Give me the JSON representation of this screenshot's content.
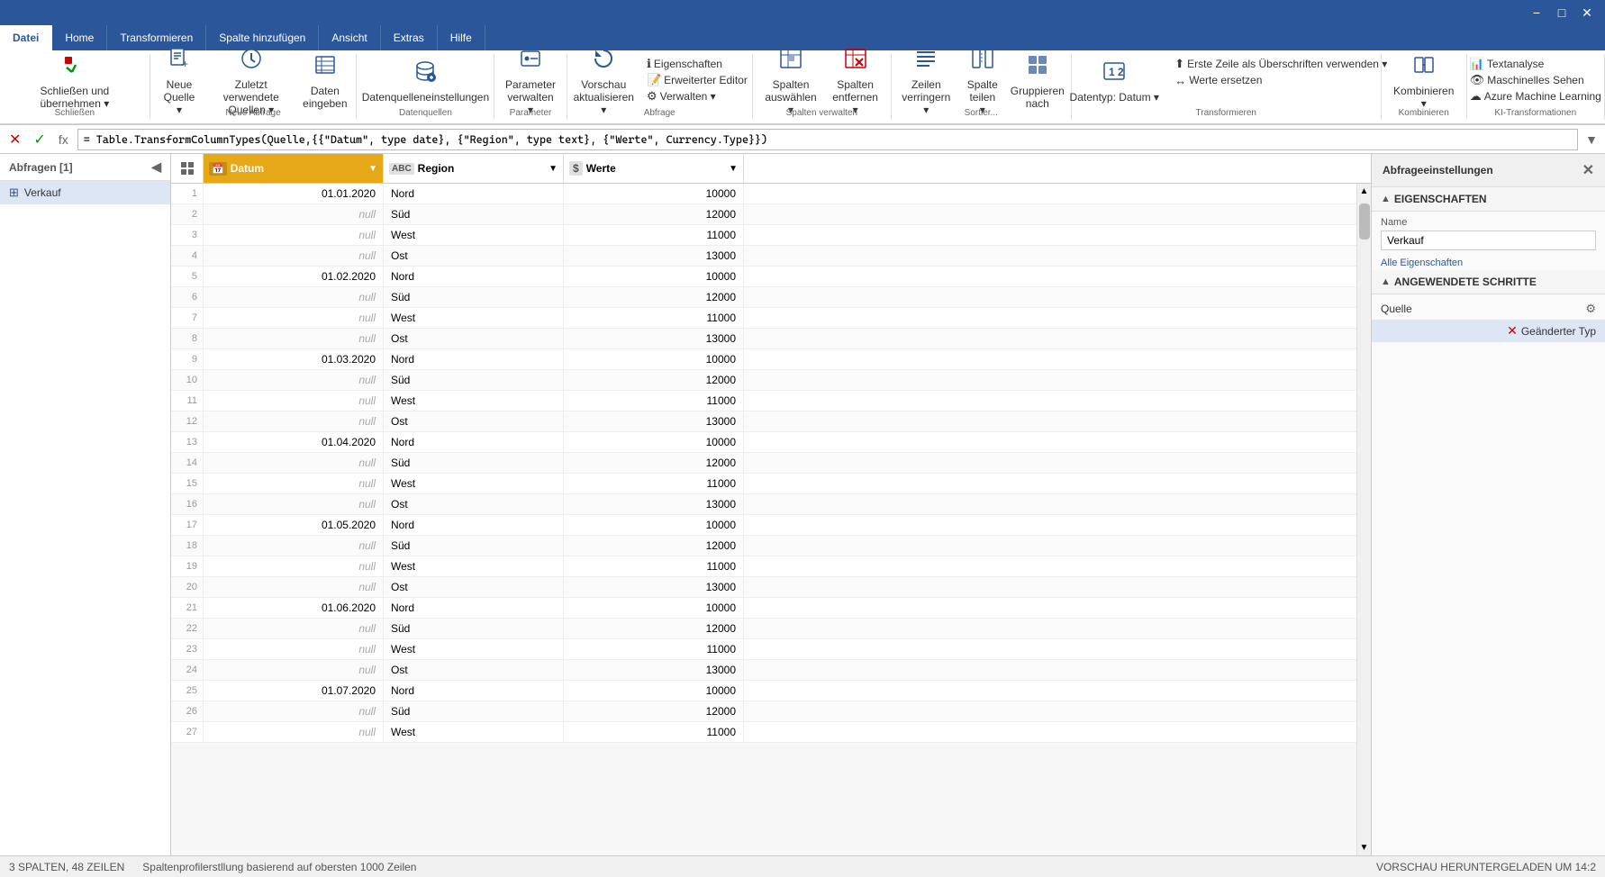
{
  "titlebar": {
    "minimize": "−",
    "maximize": "□",
    "close": "✕"
  },
  "ribbon": {
    "tabs": [
      {
        "id": "datei",
        "label": "Datei",
        "active": true
      },
      {
        "id": "home",
        "label": "Home",
        "active": false
      },
      {
        "id": "transformieren",
        "label": "Transformieren",
        "active": false
      },
      {
        "id": "spalte_hinzufuegen",
        "label": "Spalte hinzufügen",
        "active": false
      },
      {
        "id": "ansicht",
        "label": "Ansicht",
        "active": false
      },
      {
        "id": "extras",
        "label": "Extras",
        "active": false
      },
      {
        "id": "hilfe",
        "label": "Hilfe",
        "active": false
      }
    ],
    "groups": {
      "schliessen": {
        "label": "Schließen",
        "buttons": [
          {
            "id": "schliessen_uebernehmen",
            "icon": "✓",
            "label": "Schließen und\nübernehmen ▾"
          }
        ]
      },
      "neue_abfrage": {
        "label": "Neue Abfrage",
        "buttons": [
          {
            "id": "neue_quelle",
            "icon": "📄",
            "label": "Neue\nQuelle ▾"
          },
          {
            "id": "zuletzt",
            "icon": "🕐",
            "label": "Zuletzt verwendete\nQuellen ▾"
          },
          {
            "id": "daten_eingeben",
            "icon": "📋",
            "label": "Daten\neingeben"
          }
        ]
      },
      "datenquellen": {
        "label": "Datenquellen",
        "buttons": [
          {
            "id": "datenquelleneinstellungen",
            "icon": "🔌",
            "label": "Datenquelleneinstellungen"
          }
        ]
      },
      "parameter": {
        "label": "Parameter",
        "buttons": [
          {
            "id": "parameter_verwalten",
            "icon": "⚙",
            "label": "Parameter\nverwalten ▾"
          }
        ]
      },
      "abfrage": {
        "label": "Abfrage",
        "buttons": [
          {
            "id": "vorschau_aktualisieren",
            "icon": "🔄",
            "label": "Vorschau\naktualisieren ▾"
          },
          {
            "id": "eigenschaften",
            "icon": "ℹ",
            "label": "Eigenschaften"
          },
          {
            "id": "erweiterter_editor",
            "icon": "📝",
            "label": "Erweiterter Editor"
          },
          {
            "id": "verwalten",
            "icon": "⚙",
            "label": "Verwalten ▾"
          }
        ]
      },
      "spalten_verwalten": {
        "label": "Spalten verwalten",
        "buttons": [
          {
            "id": "spalten_auswaehlen",
            "icon": "▦",
            "label": "Spalten\nauswählen ▾"
          },
          {
            "id": "spalten_entfernen",
            "icon": "✂",
            "label": "Spalten\nentfernen ▾"
          }
        ]
      },
      "sortier": {
        "label": "Sortier...",
        "buttons": [
          {
            "id": "zeilen_verringern",
            "icon": "≡",
            "label": "Zeilen\nverringern ▾"
          },
          {
            "id": "spalte_teilen",
            "icon": "⧺",
            "label": "Spalte\nteilen ▾"
          },
          {
            "id": "gruppieren_nach",
            "icon": "⊞",
            "label": "Gruppieren\nnach"
          }
        ]
      },
      "transformieren": {
        "label": "Transformieren",
        "buttons": [
          {
            "id": "datentyp",
            "icon": "🔢",
            "label": "Datentyp: Datum ▾"
          },
          {
            "id": "erste_zeile",
            "icon": "⬆",
            "label": "Erste Zeile als Überschriften verwenden ▾"
          },
          {
            "id": "werte_ersetzen",
            "icon": "↔",
            "label": "Werte ersetzen"
          }
        ]
      },
      "kombinieren": {
        "label": "Kombinieren",
        "buttons": [
          {
            "id": "kombinieren_btn",
            "icon": "⊕",
            "label": "Kombinieren ▾"
          }
        ]
      },
      "ki_transformationen": {
        "label": "KI-Transformationen",
        "buttons": [
          {
            "id": "textanalyse",
            "icon": "📊",
            "label": "Textanalyse"
          },
          {
            "id": "maschinelles_sehen",
            "icon": "👁",
            "label": "Maschinelles Sehen"
          },
          {
            "id": "azure_ml",
            "icon": "☁",
            "label": "Azure Machine Learning"
          }
        ]
      }
    }
  },
  "formula_bar": {
    "cancel": "✕",
    "confirm": "✓",
    "fx": "fx",
    "formula": "= Table.TransformColumnTypes(Quelle,{{\"Datum\", type date}, {\"Region\", type text}, {\"Werte\", Currency.Type}})"
  },
  "queries_panel": {
    "header": "Abfragen [1]",
    "items": [
      {
        "id": "verkauf",
        "label": "Verkauf",
        "active": true
      }
    ]
  },
  "grid": {
    "columns": [
      {
        "id": "datum",
        "label": "Datum",
        "type_icon": "📅",
        "type_text": "Dat",
        "active": true
      },
      {
        "id": "region",
        "label": "Region",
        "type_icon": "ABC",
        "type_text": "ABC",
        "active": false
      },
      {
        "id": "werte",
        "label": "Werte",
        "type_icon": "$",
        "type_text": "$",
        "active": false
      }
    ],
    "rows": [
      {
        "num": 1,
        "datum": "01.01.2020",
        "region": "Nord",
        "werte": "10000"
      },
      {
        "num": 2,
        "datum": "null",
        "region": "Süd",
        "werte": "12000"
      },
      {
        "num": 3,
        "datum": "null",
        "region": "West",
        "werte": "11000"
      },
      {
        "num": 4,
        "datum": "null",
        "region": "Ost",
        "werte": "13000"
      },
      {
        "num": 5,
        "datum": "01.02.2020",
        "region": "Nord",
        "werte": "10000"
      },
      {
        "num": 6,
        "datum": "null",
        "region": "Süd",
        "werte": "12000"
      },
      {
        "num": 7,
        "datum": "null",
        "region": "West",
        "werte": "11000"
      },
      {
        "num": 8,
        "datum": "null",
        "region": "Ost",
        "werte": "13000"
      },
      {
        "num": 9,
        "datum": "01.03.2020",
        "region": "Nord",
        "werte": "10000"
      },
      {
        "num": 10,
        "datum": "null",
        "region": "Süd",
        "werte": "12000"
      },
      {
        "num": 11,
        "datum": "null",
        "region": "West",
        "werte": "11000"
      },
      {
        "num": 12,
        "datum": "null",
        "region": "Ost",
        "werte": "13000"
      },
      {
        "num": 13,
        "datum": "01.04.2020",
        "region": "Nord",
        "werte": "10000"
      },
      {
        "num": 14,
        "datum": "null",
        "region": "Süd",
        "werte": "12000"
      },
      {
        "num": 15,
        "datum": "null",
        "region": "West",
        "werte": "11000"
      },
      {
        "num": 16,
        "datum": "null",
        "region": "Ost",
        "werte": "13000"
      },
      {
        "num": 17,
        "datum": "01.05.2020",
        "region": "Nord",
        "werte": "10000"
      },
      {
        "num": 18,
        "datum": "null",
        "region": "Süd",
        "werte": "12000"
      },
      {
        "num": 19,
        "datum": "null",
        "region": "West",
        "werte": "11000"
      },
      {
        "num": 20,
        "datum": "null",
        "region": "Ost",
        "werte": "13000"
      },
      {
        "num": 21,
        "datum": "01.06.2020",
        "region": "Nord",
        "werte": "10000"
      },
      {
        "num": 22,
        "datum": "null",
        "region": "Süd",
        "werte": "12000"
      },
      {
        "num": 23,
        "datum": "null",
        "region": "West",
        "werte": "11000"
      },
      {
        "num": 24,
        "datum": "null",
        "region": "Ost",
        "werte": "13000"
      },
      {
        "num": 25,
        "datum": "01.07.2020",
        "region": "Nord",
        "werte": "10000"
      },
      {
        "num": 26,
        "datum": "null",
        "region": "Süd",
        "werte": "12000"
      },
      {
        "num": 27,
        "datum": "null",
        "region": "West",
        "werte": "11000"
      }
    ]
  },
  "right_panel": {
    "title": "Abfrageeinstellungen",
    "close": "✕",
    "sections": {
      "eigenschaften": {
        "label": "EIGENSCHAFTEN",
        "name_label": "Name",
        "name_value": "Verkauf",
        "all_props_link": "Alle Eigenschaften"
      },
      "angewendete_schritte": {
        "label": "ANGEWENDETE SCHRITTE",
        "steps": [
          {
            "id": "quelle",
            "label": "Quelle",
            "has_gear": true,
            "active": false
          },
          {
            "id": "geaenderter_typ",
            "label": "Geänderter Typ",
            "has_delete": true,
            "active": true
          }
        ]
      }
    }
  },
  "status_bar": {
    "left": "3 SPALTEN, 48 ZEILEN",
    "middle": "Spaltenprofilerstllung basierend auf obersten 1000 Zeilen",
    "right": "VORSCHAU HERUNTERGELADEN UM 14:2"
  }
}
